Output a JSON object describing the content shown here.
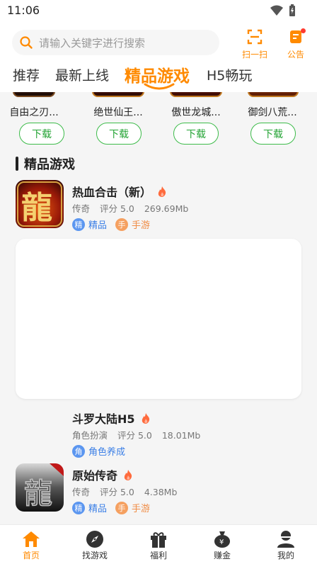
{
  "status": {
    "time": "11:06"
  },
  "header": {
    "search_placeholder": "请输入关键字进行搜索",
    "scan_label": "扫一扫",
    "notice_label": "公告"
  },
  "tabs": [
    {
      "label": "推荐",
      "active": false
    },
    {
      "label": "最新上线",
      "active": false
    },
    {
      "label": "精品游戏",
      "active": true
    },
    {
      "label": "H5畅玩",
      "active": false
    }
  ],
  "hot_row": [
    {
      "name": "自由之刃...",
      "download": "下载"
    },
    {
      "name": "绝世仙王...",
      "download": "下载"
    },
    {
      "name": "傲世龙城...",
      "download": "下载"
    },
    {
      "name": "御剑八荒...",
      "download": "下载"
    }
  ],
  "section": {
    "title": "精品游戏"
  },
  "games": [
    {
      "name": "热血合击（新）",
      "genre": "传奇",
      "rating": "评分 5.0",
      "size": "269.69Mb",
      "tags": [
        {
          "badge": "精",
          "label": "精品",
          "color": "blue"
        },
        {
          "badge": "手",
          "label": "手游",
          "color": "orange"
        }
      ]
    },
    {
      "name": "斗罗大陆H5",
      "genre": "角色扮演",
      "rating": "评分 5.0",
      "size": "18.01Mb",
      "tags": [
        {
          "badge": "角",
          "label": "角色养成",
          "color": "blue"
        }
      ]
    },
    {
      "name": "原始传奇",
      "genre": "传奇",
      "rating": "评分 5.0",
      "size": "4.38Mb",
      "tags": [
        {
          "badge": "精",
          "label": "精品",
          "color": "blue"
        },
        {
          "badge": "手",
          "label": "手游",
          "color": "orange"
        }
      ]
    }
  ],
  "bottom_nav": [
    {
      "label": "首页",
      "active": true
    },
    {
      "label": "找游戏",
      "active": false
    },
    {
      "label": "福利",
      "active": false
    },
    {
      "label": "赚金",
      "active": false
    },
    {
      "label": "我的",
      "active": false
    }
  ],
  "colors": {
    "accent": "#ff8a00",
    "download_green": "#23a334"
  }
}
